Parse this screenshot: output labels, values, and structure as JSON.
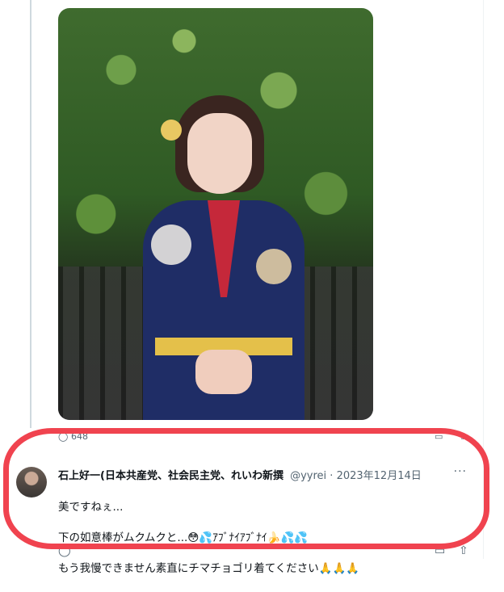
{
  "top_actions": {
    "reply_count": "648"
  },
  "reply": {
    "display_name": "石上好一(日本共産党、社会民主党、れいわ新撰",
    "handle": "@yyrei",
    "separator": "·",
    "date": "2023年12月14日",
    "more": "···",
    "lines": [
      "美ですねぇ...",
      "下の如意棒がムクムクと...😳💦ｱﾌﾞﾅｲｱﾌﾞﾅｲ🍌💦💦",
      "もう我慢できません素直にチマチョゴリ着てください🙏🙏🙏"
    ]
  },
  "icons": {
    "top_reply": "comment-icon",
    "top_bookmark": "bookmark-icon",
    "top_share": "share-icon",
    "bottom_reply": "comment-icon",
    "bottom_bookmark": "bookmark-icon",
    "bottom_share": "share-icon"
  },
  "colors": {
    "highlight": "#f0434f",
    "secondary_text": "#536471",
    "thread_line": "#cfd9de"
  }
}
